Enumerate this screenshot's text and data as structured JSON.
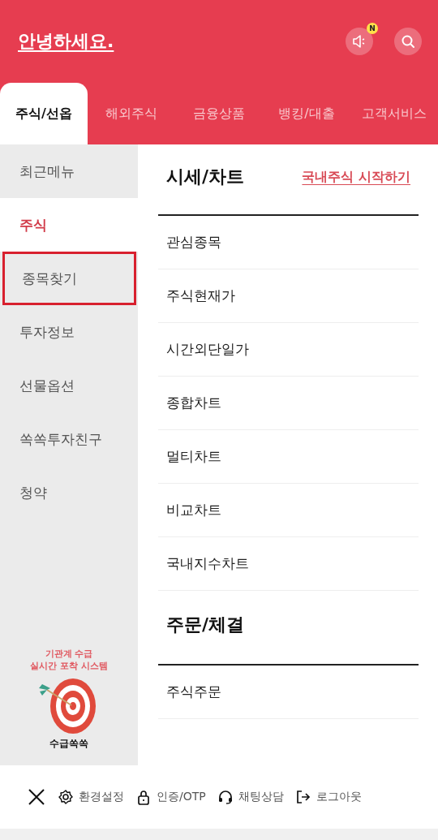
{
  "header": {
    "greeting": "안녕하세요.",
    "notice_badge": "N"
  },
  "tabs": [
    {
      "label": "주식/선옵",
      "selected": true
    },
    {
      "label": "해외주식",
      "selected": false
    },
    {
      "label": "금융상품",
      "selected": false
    },
    {
      "label": "뱅킹/대출",
      "selected": false
    },
    {
      "label": "고객서비스",
      "selected": false
    }
  ],
  "sidebar": {
    "items": [
      {
        "label": "최근메뉴",
        "selected": false,
        "highlighted": false
      },
      {
        "label": "주식",
        "selected": true,
        "highlighted": false
      },
      {
        "label": "종목찾기",
        "selected": false,
        "highlighted": true
      },
      {
        "label": "투자정보",
        "selected": false,
        "highlighted": false
      },
      {
        "label": "선물옵션",
        "selected": false,
        "highlighted": false
      },
      {
        "label": "쏙쏙투자친구",
        "selected": false,
        "highlighted": false
      },
      {
        "label": "청약",
        "selected": false,
        "highlighted": false
      }
    ],
    "promo": {
      "headline_1": "기관계 수급",
      "headline_2": "실시간 포착 시스템",
      "name": "수급쏙쏙"
    }
  },
  "sections": [
    {
      "title": "시세/차트",
      "link": "국내주식 시작하기",
      "items": [
        "관심종목",
        "주식현재가",
        "시간외단일가",
        "종합차트",
        "멀티차트",
        "비교차트",
        "국내지수차트"
      ]
    },
    {
      "title": "주문/체결",
      "items": [
        "주식주문"
      ]
    }
  ],
  "footer": [
    {
      "kind": "close"
    },
    {
      "kind": "settings",
      "label": "환경설정"
    },
    {
      "kind": "lock",
      "label": "인증/OTP"
    },
    {
      "kind": "headset",
      "label": "채팅상담"
    },
    {
      "kind": "logout",
      "label": "로그아웃"
    }
  ]
}
